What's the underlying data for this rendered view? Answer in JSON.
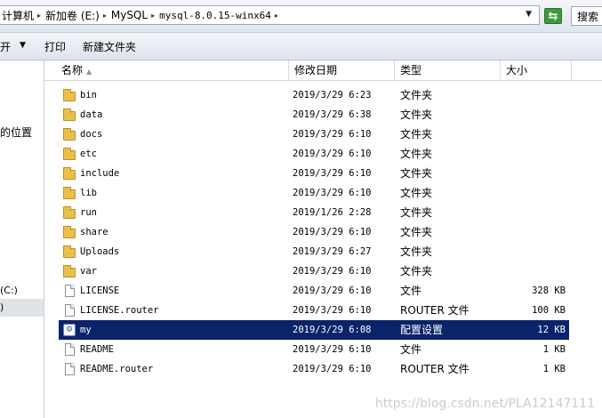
{
  "address": {
    "crumbs": [
      {
        "label": "计算机",
        "mono": false
      },
      {
        "label": "新加卷 (E:)",
        "mono": false
      },
      {
        "label": "MySQL",
        "mono": false
      },
      {
        "label": "mysql-8.0.15-winx64",
        "mono": true
      }
    ],
    "search_placeholder": "搜索"
  },
  "toolbar": {
    "open_label": "开",
    "print_label": "打印",
    "new_folder_label": "新建文件夹"
  },
  "nav": {
    "items": [
      {
        "label": "的位置"
      },
      {
        "label": "(C:)"
      },
      {
        "label": ")"
      }
    ]
  },
  "columns": {
    "name": "名称",
    "date": "修改日期",
    "type": "类型",
    "size": "大小"
  },
  "files": [
    {
      "name": "bin",
      "date": "2019/3/29 6:23",
      "type": "文件夹",
      "size": "",
      "kind": "folder"
    },
    {
      "name": "data",
      "date": "2019/3/29 6:38",
      "type": "文件夹",
      "size": "",
      "kind": "folder"
    },
    {
      "name": "docs",
      "date": "2019/3/29 6:10",
      "type": "文件夹",
      "size": "",
      "kind": "folder"
    },
    {
      "name": "etc",
      "date": "2019/3/29 6:10",
      "type": "文件夹",
      "size": "",
      "kind": "folder"
    },
    {
      "name": "include",
      "date": "2019/3/29 6:10",
      "type": "文件夹",
      "size": "",
      "kind": "folder"
    },
    {
      "name": "lib",
      "date": "2019/3/29 6:10",
      "type": "文件夹",
      "size": "",
      "kind": "folder"
    },
    {
      "name": "run",
      "date": "2019/1/26 2:28",
      "type": "文件夹",
      "size": "",
      "kind": "folder"
    },
    {
      "name": "share",
      "date": "2019/3/29 6:10",
      "type": "文件夹",
      "size": "",
      "kind": "folder"
    },
    {
      "name": "Uploads",
      "date": "2019/3/29 6:27",
      "type": "文件夹",
      "size": "",
      "kind": "folder"
    },
    {
      "name": "var",
      "date": "2019/3/29 6:10",
      "type": "文件夹",
      "size": "",
      "kind": "folder"
    },
    {
      "name": "LICENSE",
      "date": "2019/3/29 6:10",
      "type": "文件",
      "size": "328 KB",
      "kind": "file"
    },
    {
      "name": "LICENSE.router",
      "date": "2019/3/29 6:10",
      "type": "ROUTER 文件",
      "size": "100 KB",
      "kind": "file"
    },
    {
      "name": "my",
      "date": "2019/3/29 6:08",
      "type": "配置设置",
      "size": "12 KB",
      "kind": "config",
      "selected": true
    },
    {
      "name": "README",
      "date": "2019/3/29 6:10",
      "type": "文件",
      "size": "1 KB",
      "kind": "file"
    },
    {
      "name": "README.router",
      "date": "2019/3/29 6:10",
      "type": "ROUTER 文件",
      "size": "1 KB",
      "kind": "file"
    }
  ],
  "watermark": "https://blog.csdn.net/PLA12147111",
  "colors": {
    "selection": "#0a246a",
    "folder": "#e9c14a"
  }
}
